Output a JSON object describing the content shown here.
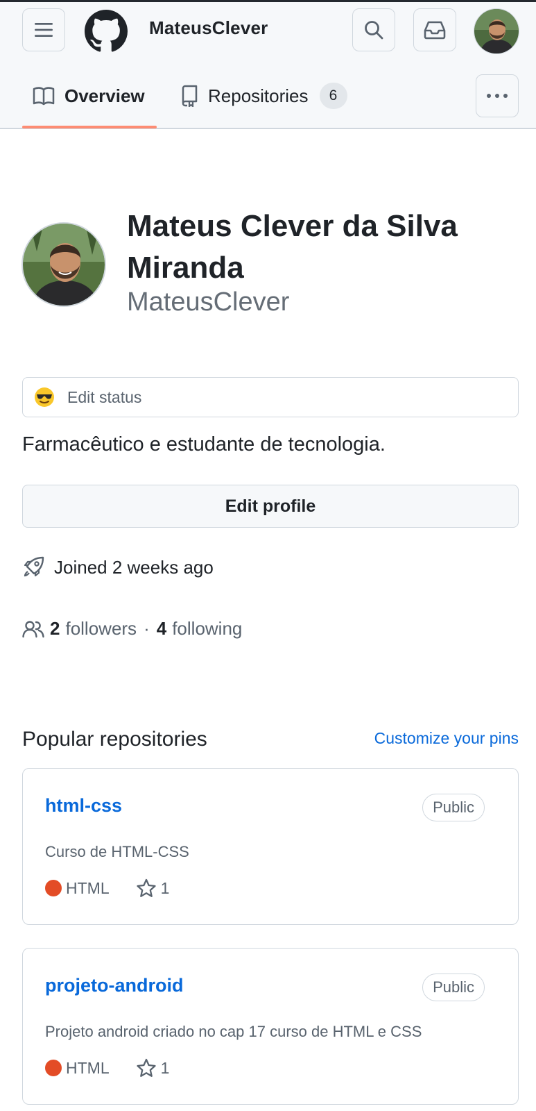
{
  "header": {
    "username": "MateusClever"
  },
  "tabs": [
    {
      "label": "Overview",
      "icon": "book-icon",
      "active": true
    },
    {
      "label": "Repositories",
      "icon": "repo-icon",
      "count": "6"
    }
  ],
  "profile": {
    "full_name": "Mateus Clever da Silva Miranda",
    "login": "MateusClever",
    "status_label": "Edit status",
    "status_emoji": "sunglasses-emoji",
    "bio": "Farmacêutico e estudante de tecnologia.",
    "edit_profile_label": "Edit profile",
    "joined": "Joined 2 weeks ago",
    "followers_count": "2",
    "followers_label": "followers",
    "separator": "·",
    "following_count": "4",
    "following_label": "following"
  },
  "popular": {
    "title": "Popular repositories",
    "customize_label": "Customize your pins",
    "repos": [
      {
        "name": "html-css",
        "visibility": "Public",
        "description": "Curso de HTML-CSS",
        "language": "HTML",
        "language_color": "#e34c26",
        "stars": "1"
      },
      {
        "name": "projeto-android",
        "visibility": "Public",
        "description": "Projeto android criado no cap 17 curso de HTML e CSS",
        "language": "HTML",
        "language_color": "#e34c26",
        "stars": "1"
      }
    ]
  },
  "colors": {
    "accent_link": "#0969da",
    "tab_underline": "#fd8c73",
    "html_lang": "#e34c26"
  }
}
